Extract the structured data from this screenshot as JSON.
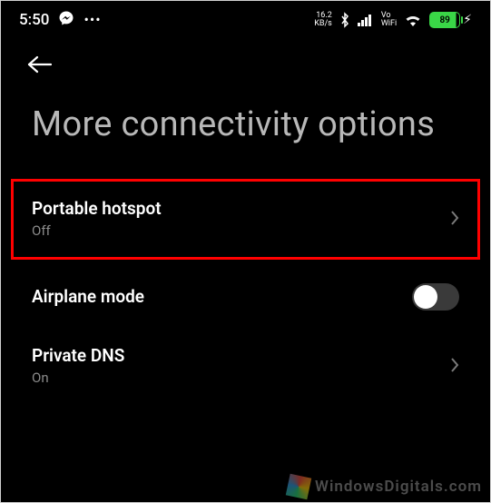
{
  "status": {
    "time": "5:50",
    "ellipsis": "•••",
    "netspeed_top": "16.2",
    "netspeed_bot": "KB/s",
    "vowifi_top": "Vo",
    "vowifi_bot": "WiFi",
    "battery_pct": "89"
  },
  "page": {
    "title": "More connectivity options"
  },
  "rows": {
    "hotspot": {
      "title": "Portable hotspot",
      "sub": "Off"
    },
    "airplane": {
      "title": "Airplane mode",
      "enabled": false
    },
    "dns": {
      "title": "Private DNS",
      "sub": "On"
    }
  },
  "watermark": "WindowsDigitals.com"
}
